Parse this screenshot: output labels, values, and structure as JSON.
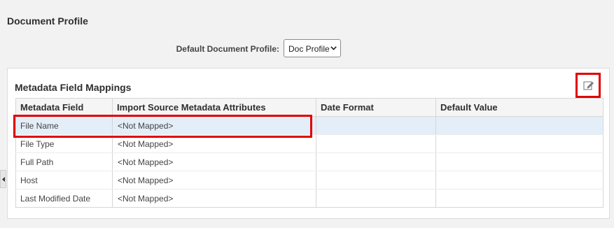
{
  "page": {
    "title": "Document Profile"
  },
  "profile": {
    "label": "Default Document Profile:",
    "selected": "Doc Profile"
  },
  "mappings": {
    "title": "Metadata Field Mappings",
    "edit_icon": "edit-pencil-icon",
    "columns": [
      "Metadata Field",
      "Import Source Metadata Attributes",
      "Date Format",
      "Default Value"
    ],
    "rows": [
      {
        "field": "File Name",
        "attribute": "<Not Mapped>",
        "date_format": "",
        "default_value": ""
      },
      {
        "field": "File Type",
        "attribute": "<Not Mapped>",
        "date_format": "",
        "default_value": ""
      },
      {
        "field": "Full Path",
        "attribute": "<Not Mapped>",
        "date_format": "",
        "default_value": ""
      },
      {
        "field": "Host",
        "attribute": "<Not Mapped>",
        "date_format": "",
        "default_value": ""
      },
      {
        "field": "Last Modified Date",
        "attribute": "<Not Mapped>",
        "date_format": "",
        "default_value": ""
      }
    ]
  },
  "colors": {
    "highlight": "#e00000",
    "selected_row": "#e4eef8"
  }
}
